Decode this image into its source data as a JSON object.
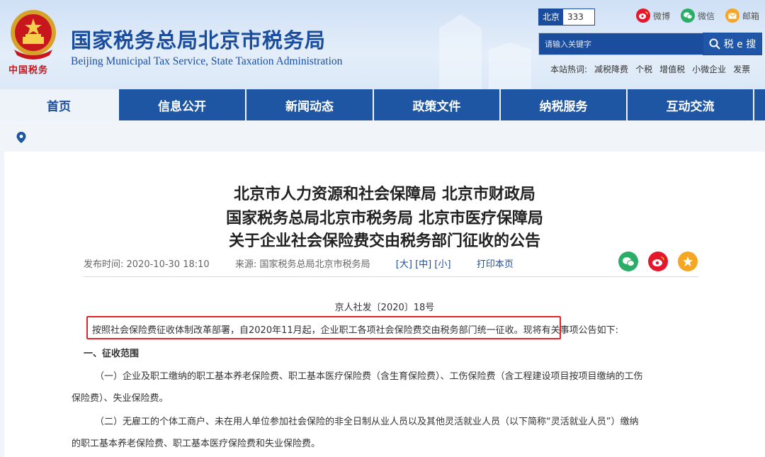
{
  "header": {
    "emblem_caption": "中国税务",
    "title": "国家税务总局北京市税务局",
    "subtitle": "Beijing Municipal Tax Service, State Taxation Administration",
    "region_label": "北京",
    "region_value": "333",
    "social": [
      {
        "label": "微博",
        "icon": "weibo-icon",
        "color": "#e6162d"
      },
      {
        "label": "微信",
        "icon": "wechat-icon",
        "color": "#2aae67"
      },
      {
        "label": "邮箱",
        "icon": "mail-icon",
        "color": "#f5a623"
      }
    ],
    "search_placeholder": "请输入关键字",
    "search_button": "税 e 搜",
    "hot_label": "本站热词:",
    "hot_words": [
      "减税降费",
      "个税",
      "增值税",
      "小微企业",
      "发票"
    ]
  },
  "nav": {
    "items": [
      "首页",
      "信息公开",
      "新闻动态",
      "政策文件",
      "纳税服务",
      "互动交流"
    ],
    "active": "首页"
  },
  "article": {
    "title_lines": [
      "北京市人力资源和社会保障局 北京市财政局",
      "国家税务总局北京市税务局 北京市医疗保障局",
      "关于企业社会保险费交由税务部门征收的公告"
    ],
    "publish_label": "发布时间:",
    "publish_time": "2020-10-30 18:10",
    "source_label": "来源:",
    "source": "国家税务总局北京市税务局",
    "font_large": "[大]",
    "font_medium": "[中]",
    "font_small": "[小]",
    "print": "打印本页",
    "doc_number": "京人社发〔2020〕18号",
    "intro_highlight": "按照社会保险费征收体制改革部署，自2020年11月起，企业职工各项社会保险费交由税务部门统一征收。",
    "intro_rest": "现将有关事项公告如下:",
    "section1": "一、征收范围",
    "para1_line1": "（一）企业及职工缴纳的职工基本养老保险费、职工基本医疗保险费（含生育保险费）、工伤保险费（含工程建设项目按项目缴纳的工伤",
    "para1_line2": "保险费）、失业保险费。",
    "para2_line1": "（二）无雇工的个体工商户、未在用人单位参加社会保险的非全日制从业人员以及其他灵活就业人员（以下简称“灵活就业人员”）缴纳",
    "para2_line2": "的职工基本养老保险费、职工基本医疗保险费和失业保险费。"
  },
  "colors": {
    "brand_blue": "#1b4d9e",
    "nav_blue": "#1e56a4",
    "highlight_red": "#e3242b"
  }
}
